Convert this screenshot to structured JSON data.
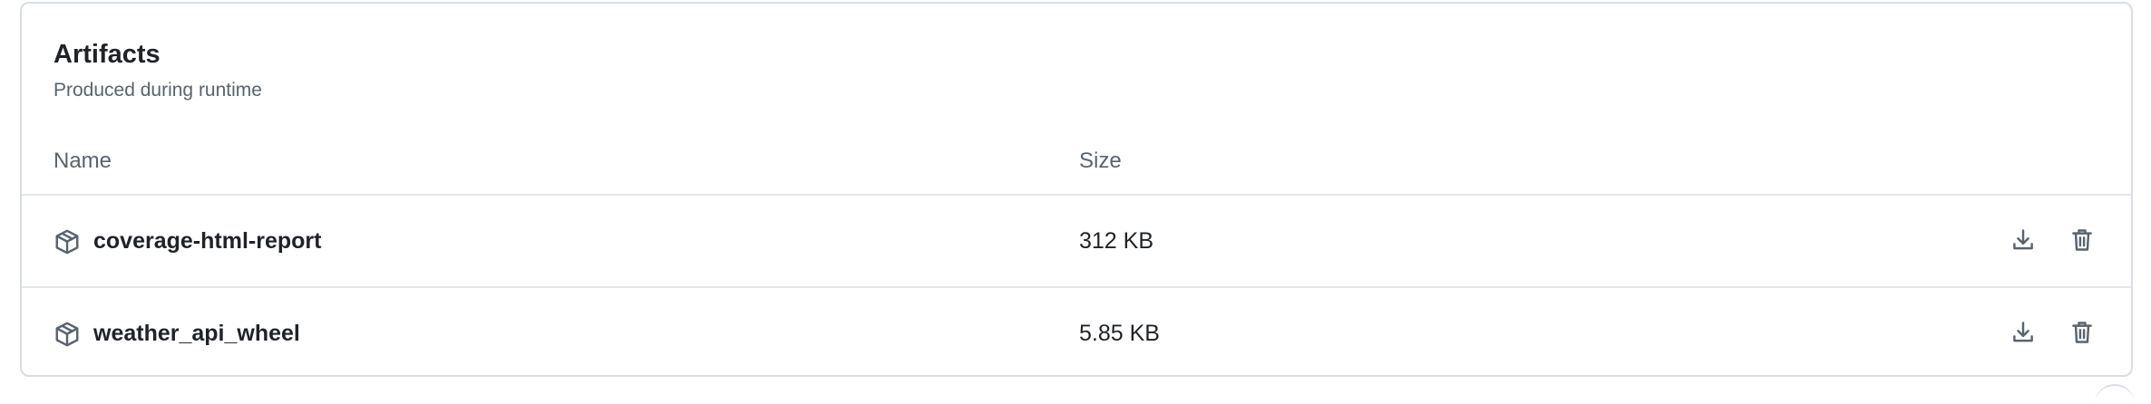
{
  "artifacts": {
    "title": "Artifacts",
    "subtitle": "Produced during runtime",
    "columns": {
      "name": "Name",
      "size": "Size"
    },
    "rows": [
      {
        "name": "coverage-html-report",
        "size": "312 KB",
        "icon": "package-icon"
      },
      {
        "name": "weather_api_wheel",
        "size": "5.85 KB",
        "icon": "package-icon"
      }
    ],
    "row_actions": [
      "download-icon",
      "trash-icon"
    ]
  },
  "colors": {
    "text_primary": "#1f2328",
    "text_muted": "#59636e",
    "border": "#d8dee4",
    "divider": "#e4e8ec",
    "icon": "#59636e"
  }
}
